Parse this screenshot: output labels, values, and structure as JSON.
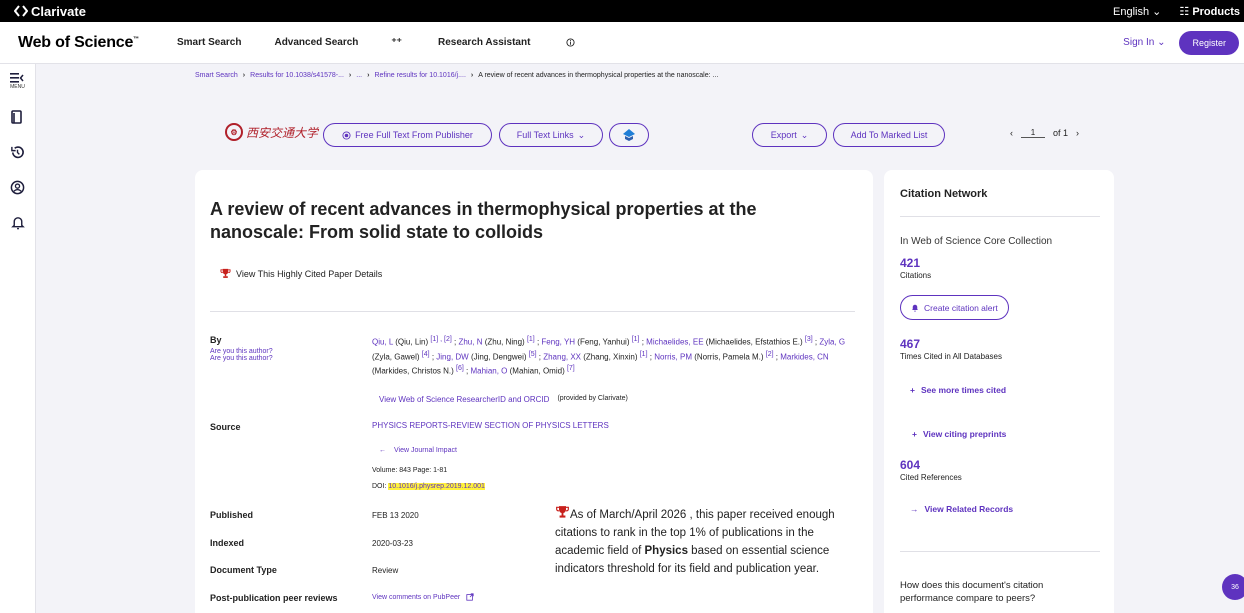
{
  "topbar": {
    "brand": "Clarivate",
    "language": "English",
    "products": "Products"
  },
  "header": {
    "logo": "Web of Science",
    "logo_tm": "™",
    "nav": [
      "Smart Search",
      "Advanced Search"
    ],
    "research_assistant": "Research Assistant",
    "sign_in": "Sign In",
    "register": "Register"
  },
  "sidenav": {
    "menu_label": "MENU"
  },
  "breadcrumb": [
    "Smart Search",
    "Results for 10.1038/s41578-...",
    "...",
    "Refine results for 10.1016/j....",
    "A review of recent advances in thermophysical properties at the nanoscale: ..."
  ],
  "toolbar": {
    "university": "西安交通大学",
    "free_full_text": "Free Full Text From Publisher",
    "full_text_links": "Full Text Links",
    "export": "Export",
    "add_marked": "Add To Marked List",
    "page_current": "1",
    "page_of": "of 1"
  },
  "record": {
    "title": "A review of recent advances in thermophysical properties at the nanoscale: From solid state to colloids",
    "highly_cited_link": "View This Highly Cited Paper Details",
    "labels": {
      "by": "By",
      "are_you": "Are you this author?",
      "source": "Source",
      "published": "Published",
      "indexed": "Indexed",
      "doc_type": "Document Type",
      "peer_reviews": "Post-publication peer reviews"
    },
    "authors": [
      {
        "short": "Qiu, L",
        "full": "(Qiu, Lin)",
        "refs": "[1] , [2]"
      },
      {
        "short": "Zhu, N",
        "full": "(Zhu, Ning)",
        "refs": "[1]"
      },
      {
        "short": "Feng, YH",
        "full": "(Feng, Yanhui)",
        "refs": "[1]"
      },
      {
        "short": "Michaelides, EE",
        "full": "(Michaelides, Efstathios E.)",
        "refs": "[3]"
      },
      {
        "short": "Zyla, G",
        "full": "(Zyla, Gawel)",
        "refs": "[4]"
      },
      {
        "short": "Jing, DW",
        "full": "(Jing, Dengwei)",
        "refs": "[5]"
      },
      {
        "short": "Zhang, XX",
        "full": "(Zhang, Xinxin)",
        "refs": "[1]"
      },
      {
        "short": "Norris, PM",
        "full": "(Norris, Pamela M.)",
        "refs": "[2]"
      },
      {
        "short": "Markides, CN",
        "full": "(Markides, Christos N.)",
        "refs": "[6]"
      },
      {
        "short": "Mahian, O",
        "full": "(Mahian, Omid)",
        "refs": "[7]"
      }
    ],
    "researcher_link": "View Web of Science ResearcherID and ORCID",
    "provided_by": "(provided by Clarivate)",
    "source": "PHYSICS REPORTS-REVIEW SECTION OF PHYSICS LETTERS",
    "journal_impact": "View Journal Impact",
    "volume_page": "Volume: 843    Page: 1-81",
    "doi_label": "DOI:",
    "doi": "10.1016/j.physrep.2019.12.001",
    "published": "FEB 13 2020",
    "indexed": "2020-03-23",
    "doc_type": "Review",
    "pubpeer": "View comments on PubPeer",
    "hc_note_pre": "As of March/April 2026 , this paper received enough citations to rank in the top 1% of publications in the academic field of ",
    "hc_field": "Physics",
    "hc_note_post": " based on essential science indicators threshold for its field and publication year."
  },
  "citation_network": {
    "title": "Citation Network",
    "subtitle": "In Web of Science Core Collection",
    "citations": "421",
    "citations_label": "Citations",
    "create_alert": "Create citation alert",
    "times_cited": "467",
    "times_cited_label": "Times Cited in All Databases",
    "see_more": "See more times cited",
    "view_preprints": "View citing preprints",
    "cited_refs": "604",
    "cited_refs_label": "Cited References",
    "view_related": "View Related Records",
    "question": "How does this document's citation performance compare to peers?"
  },
  "chat_badge": "36",
  "colors": {
    "brand": "#5e33bf",
    "highlight": "#fff23c",
    "trophy": "#c8201c"
  }
}
